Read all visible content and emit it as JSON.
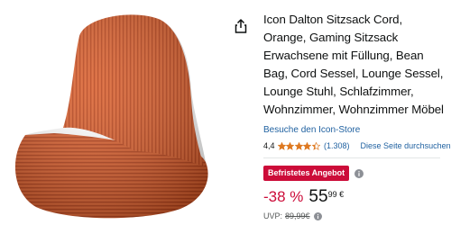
{
  "product": {
    "title": "Icon Dalton Sitzsack Cord, Orange, Gaming Sitzsack Erwachsene mit Füllung, Bean Bag, Cord Sessel, Lounge Sessel, Lounge Stuhl, Schlafzimmer, Wohnzimmer, Wohnzimmer Möbel",
    "image_icon": "orange-corduroy-bean-bag",
    "store_link": "Besuche den Icon-Store"
  },
  "rating": {
    "value_text": "4,4",
    "stars": 4.4,
    "review_count": "(1.308)",
    "search_page_link": "Diese Seite durchsuchen"
  },
  "deal": {
    "badge": "Befristetes Angebot"
  },
  "price": {
    "discount": "-38 %",
    "whole": "55",
    "fraction": "99 €"
  },
  "uvp": {
    "label": "UVP:",
    "value": "89,99€"
  },
  "colors": {
    "accent_red": "#cc0c39",
    "link_blue": "#2162a1",
    "star_orange": "#de7921",
    "product_orange": "#d2592b"
  },
  "icons": {
    "share": "share-icon",
    "info": "info-icon",
    "chevron": "chevron-down-icon",
    "star": "star-icon"
  }
}
